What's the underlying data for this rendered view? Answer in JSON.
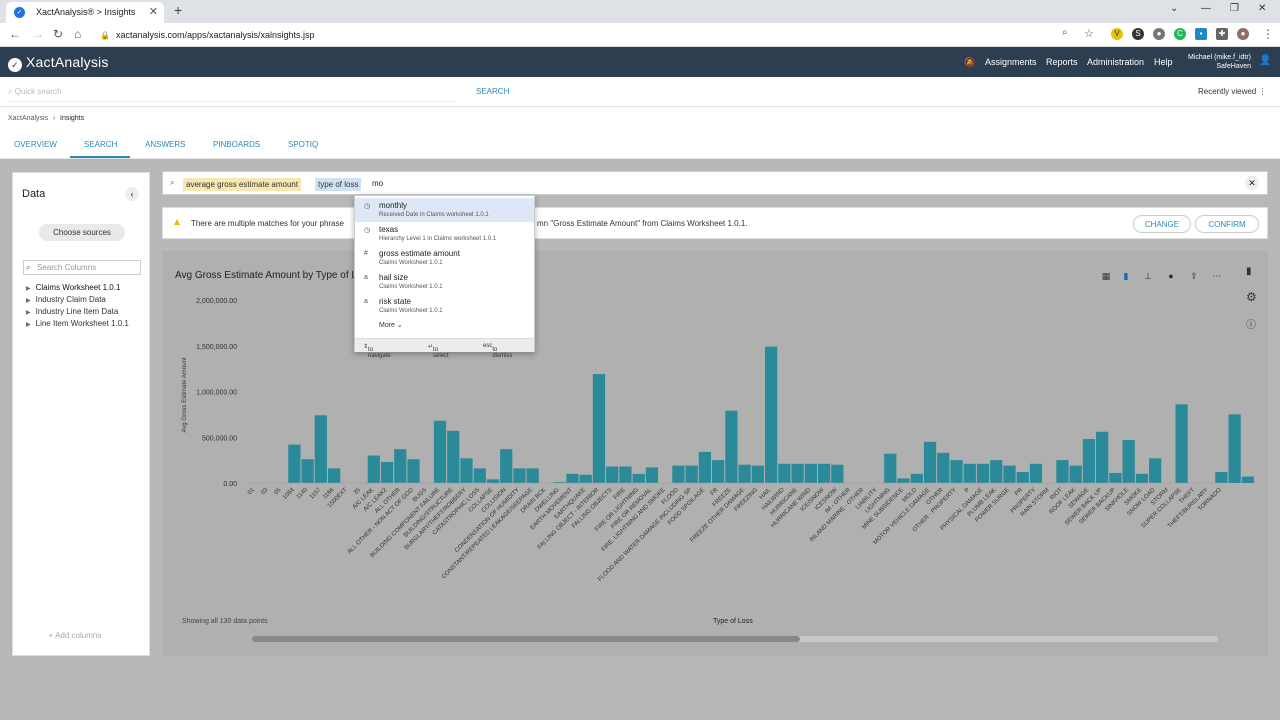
{
  "browser": {
    "tab_title": "XactAnalysis® > Insights",
    "url": "xactanalysis.com/apps/xactanalysis/xalnsights.jsp"
  },
  "header": {
    "logo": "XactAnalysis",
    "nav": [
      "Assignments",
      "Reports",
      "Administration",
      "Help"
    ],
    "user_line1": "Michael (mike.f_idtr)",
    "user_line2": "SafeHaven"
  },
  "quick_search": {
    "placeholder": "Quick search",
    "button": "SEARCH",
    "recent": "Recently viewed"
  },
  "breadcrumb": [
    "XactAnalysis",
    "Insights"
  ],
  "tabs": [
    "OVERVIEW",
    "SEARCH",
    "ANSWERS",
    "PINBOARDS",
    "SPOTIQ"
  ],
  "left_panel": {
    "title": "Data",
    "choose_sources": "Choose sources",
    "search_placeholder": "Search Columns",
    "sources": [
      "Claims Worksheet 1.0.1",
      "Industry Claim Data",
      "Industry Line Item Data",
      "Line Item Worksheet 1.0.1"
    ],
    "add_columns": "Add columns"
  },
  "search": {
    "token1": "average gross estimate amount",
    "token2": "type of loss",
    "typed": "mo"
  },
  "warning": {
    "msg1": "There are multiple matches for your phrase",
    "msg2": "mn \"Gross Estimate Amount\" from Claims Worksheet 1.0.1.",
    "change": "CHANGE",
    "confirm": "CONFIRM"
  },
  "dropdown": {
    "items": [
      {
        "name": "monthly",
        "src": "Received Date in Claims worksheet 1.0.1",
        "icon": "clock-icon"
      },
      {
        "name": "texas",
        "src": "Hierarchy Level 1 in Claims worksheet 1.0.1",
        "icon": "clock-icon"
      },
      {
        "name": "gross estimate amount",
        "src": "Claims Worksheet 1.0.1",
        "icon": "hash-icon"
      },
      {
        "name": "hail size",
        "src": "Claims Worksheet 1.0.1",
        "icon": "text-icon"
      },
      {
        "name": "risk state",
        "src": "Claims Worksheet 1.0.1",
        "icon": "text-icon"
      }
    ],
    "more": "More",
    "foot": [
      "to navigate",
      "to select",
      "to dismiss"
    ]
  },
  "chart_footer": {
    "showing": "Showing all 130 data points",
    "xlabel": "Type of Loss"
  },
  "chart_data": {
    "type": "bar",
    "title": "Avg Gross Estimate Amount by Type of L",
    "xlabel": "Type of Loss",
    "ylabel": "Avg Gross Estimate Amount",
    "ylim": [
      0,
      2000000
    ],
    "yticks": [
      "2,000,000.00",
      "1,500,000.00",
      "1,000,000.00",
      "500,000.00",
      "0.00"
    ],
    "categories": [
      "01",
      "03",
      "05",
      "1064",
      "1140",
      "1157",
      "1166",
      "1500EXT",
      "35",
      "A/C LEAK",
      "A/C LEAK2",
      "ALL OTHER",
      "ALL OTHER - NON ACT OF GOD",
      "BUGS",
      "BUILDING COMPONENT FAILURE",
      "BUILDING/STRUCTURE",
      "BURGLARY/THEFT/ROBBERY",
      "CATASTROPHIC LOSS",
      "COLLAPSE",
      "COLLISION",
      "CONDENSATION OF HUMIDITY",
      "CONSTANT/REPEATED LEAKAGE/SEEPAGE",
      "DRAIN BCK",
      "DWELLING",
      "EARTH MOVEMENT",
      "EARTHQUAKE",
      "FALLING OBJECT - INTERIOR",
      "FALLING OBJECTS",
      "FIRE",
      "FIRE OR LIGHTNING",
      "FIRE OR REMOVAL",
      "FIRE, LIGHTNING AND SMOKE",
      "FLOOD",
      "FLOOD AND WATER DAMAGE INCLUDING SP",
      "FOOD SPOILAGE",
      "FR",
      "FREEZE",
      "FREEZE OTHER DAMAGE",
      "FREEZING",
      "HAIL",
      "HAILWIND",
      "HURRICANE",
      "HURRICANE WIND",
      "ICE/SNOW",
      "ICESNOW",
      "IM - OTHER",
      "INLAND MARINE - OTHER",
      "LIABILITY",
      "LIGHTNING",
      "MINE SUBSIDENCE",
      "MOLD",
      "MOTOR VEHICLE DAMAGE",
      "OTHER",
      "OTHER - PROPERTY",
      "P",
      "PHYSICAL DAMAGE",
      "PLUMB LEAK",
      "POWER SURGE",
      "PR",
      "PROPERTY",
      "RAIN STORM",
      "RIOT",
      "ROOF LEAK",
      "SEWAGE",
      "SEWER BACK UP",
      "SEWER BACKUP",
      "SINKHOLE",
      "SMOKE",
      "SNOW LOAD",
      "STORM",
      "SUPER COLLAPSE",
      "THEFT",
      "THEFT/BURGLARY",
      "TORNADO"
    ],
    "values": [
      0,
      0,
      0,
      420000,
      260000,
      740000,
      160000,
      0,
      0,
      300000,
      230000,
      370000,
      260000,
      0,
      680000,
      570000,
      270000,
      160000,
      40000,
      370000,
      160000,
      160000,
      0,
      10000,
      100000,
      90000,
      1190000,
      180000,
      180000,
      100000,
      170000,
      0,
      190000,
      190000,
      340000,
      250000,
      790000,
      200000,
      190000,
      1490000,
      210000,
      210000,
      210000,
      210000,
      200000,
      0,
      0,
      0,
      320000,
      50000,
      100000,
      450000,
      330000,
      250000,
      210000,
      210000,
      250000,
      190000,
      120000,
      210000,
      0,
      250000,
      190000,
      480000,
      560000,
      110000,
      470000,
      100000,
      270000,
      0,
      860000,
      0,
      0,
      120000,
      750000,
      70000
    ]
  }
}
